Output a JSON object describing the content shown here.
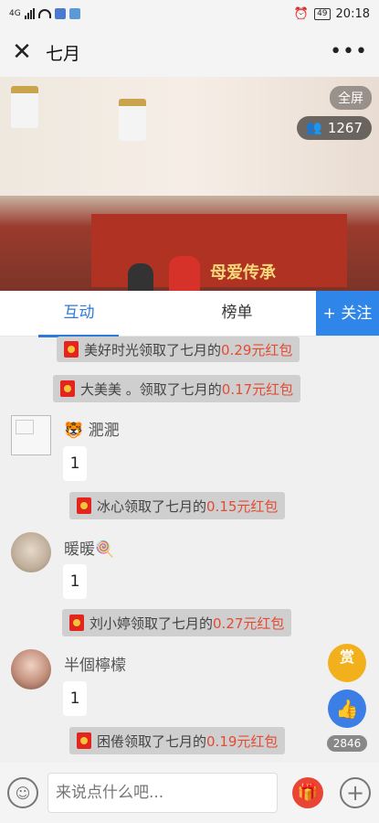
{
  "status": {
    "network": "4G",
    "time": "20:18",
    "battery": "49"
  },
  "header": {
    "title": "七月",
    "more": "•••"
  },
  "video": {
    "fullscreen": "全屏",
    "viewers": "1267",
    "banner_text": "母爱传承"
  },
  "tabs": [
    {
      "label": "互动"
    },
    {
      "label": "榜单"
    }
  ],
  "follow": "+ 关注",
  "chat": {
    "notices": [
      {
        "text": "美好时光领取了七月的",
        "amount": "0.29元红包"
      },
      {
        "text": "大美美 。领取了七月的",
        "amount": "0.17元红包"
      },
      {
        "text": "冰心领取了七月的",
        "amount": "0.15元红包"
      },
      {
        "text": "刘小婷领取了七月的",
        "amount": "0.27元红包"
      },
      {
        "text": "困倦领取了七月的",
        "amount": "0.19元红包"
      }
    ],
    "messages": [
      {
        "user": "🐯 淝淝",
        "text": "1"
      },
      {
        "user": "暖暖🍭",
        "text": "1"
      },
      {
        "user": "半個檸檬",
        "text": "1"
      }
    ]
  },
  "floating": {
    "reward": "赏",
    "likes": "2846"
  },
  "input": {
    "placeholder": "来说点什么吧..."
  },
  "colors": {
    "accent": "#2f86e8",
    "amount": "#e34b33",
    "reward": "#f2b11c",
    "gift": "#e94535"
  }
}
